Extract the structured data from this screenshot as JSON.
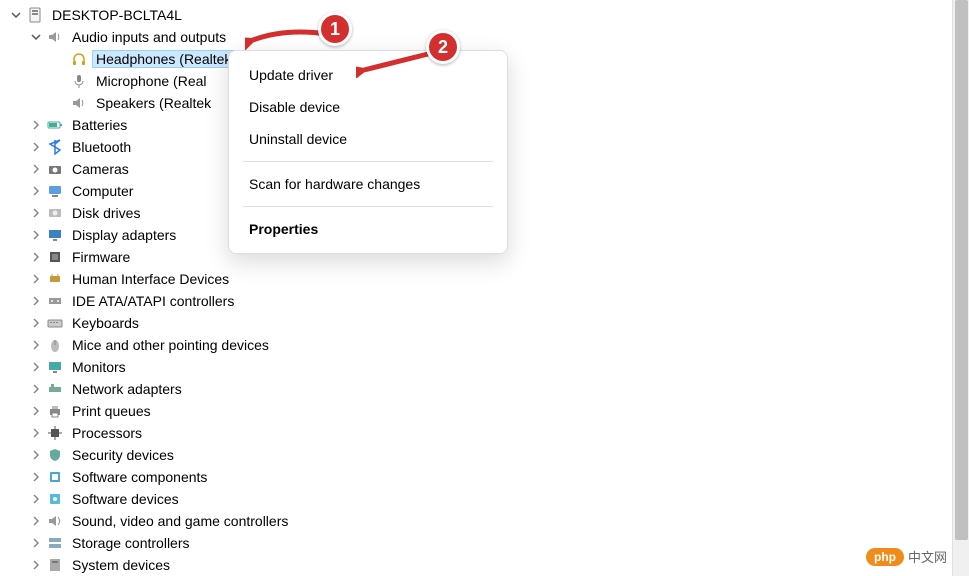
{
  "root": {
    "label": "DESKTOP-BCLTA4L"
  },
  "audio_category": {
    "label": "Audio inputs and outputs"
  },
  "audio_children": [
    {
      "label": "Headphones (Realtek(R) Audio)",
      "icon": "headphones",
      "selected": true
    },
    {
      "label": "Microphone (Real",
      "icon": "microphone"
    },
    {
      "label": "Speakers (Realtek",
      "icon": "speaker"
    }
  ],
  "categories": [
    {
      "label": "Batteries",
      "icon": "battery"
    },
    {
      "label": "Bluetooth",
      "icon": "bluetooth"
    },
    {
      "label": "Cameras",
      "icon": "camera"
    },
    {
      "label": "Computer",
      "icon": "computer"
    },
    {
      "label": "Disk drives",
      "icon": "disk"
    },
    {
      "label": "Display adapters",
      "icon": "display"
    },
    {
      "label": "Firmware",
      "icon": "firmware"
    },
    {
      "label": "Human Interface Devices",
      "icon": "hid"
    },
    {
      "label": "IDE ATA/ATAPI controllers",
      "icon": "ide"
    },
    {
      "label": "Keyboards",
      "icon": "keyboard"
    },
    {
      "label": "Mice and other pointing devices",
      "icon": "mouse"
    },
    {
      "label": "Monitors",
      "icon": "monitor"
    },
    {
      "label": "Network adapters",
      "icon": "network"
    },
    {
      "label": "Print queues",
      "icon": "printer"
    },
    {
      "label": "Processors",
      "icon": "processor"
    },
    {
      "label": "Security devices",
      "icon": "security"
    },
    {
      "label": "Software components",
      "icon": "software-comp"
    },
    {
      "label": "Software devices",
      "icon": "software-dev"
    },
    {
      "label": "Sound, video and game controllers",
      "icon": "sound"
    },
    {
      "label": "Storage controllers",
      "icon": "storage"
    },
    {
      "label": "System devices",
      "icon": "system"
    }
  ],
  "context_menu": {
    "update": "Update driver",
    "disable": "Disable device",
    "uninstall": "Uninstall device",
    "scan": "Scan for hardware changes",
    "properties": "Properties"
  },
  "callouts": {
    "one": "1",
    "two": "2"
  },
  "watermark": {
    "pill": "php",
    "text": "中文网"
  }
}
